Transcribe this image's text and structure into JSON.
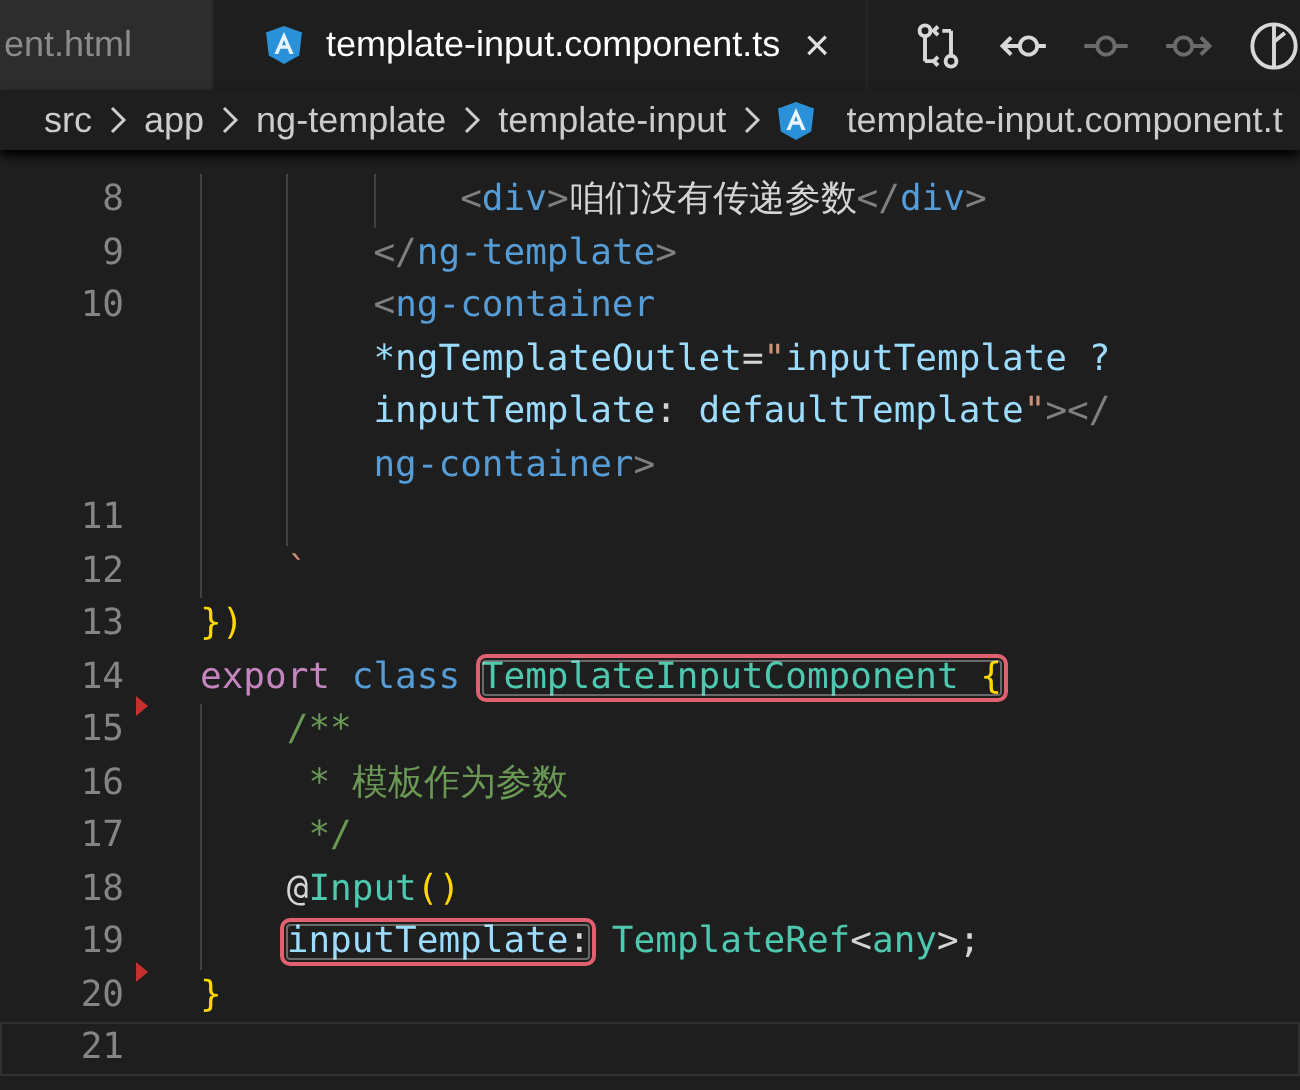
{
  "tabs": [
    {
      "label": "ent.html",
      "selected": false,
      "icon": false
    },
    {
      "label": "template-input.component.ts",
      "selected": true,
      "icon": true,
      "close": "×"
    }
  ],
  "toolbar": [
    {
      "kind": "compare",
      "disabled": false
    },
    {
      "kind": "previous",
      "disabled": false
    },
    {
      "kind": "commit",
      "disabled": true
    },
    {
      "kind": "next",
      "disabled": true
    },
    {
      "kind": "graph",
      "disabled": false
    }
  ],
  "breadcrumb": [
    {
      "label": "src",
      "icon": false
    },
    {
      "label": "app",
      "icon": false
    },
    {
      "label": "ng-template",
      "icon": false
    },
    {
      "label": "template-input",
      "icon": false
    },
    {
      "label": "template-input.component.t",
      "icon": true
    }
  ],
  "lines": [
    {
      "number": "8",
      "marker": false,
      "current": false,
      "rows": [
        {
          "indent": [
            {
              "guide": true
            },
            {
              "guide": true
            },
            {
              "guide": true
            }
          ],
          "tokens": [
            {
              "text": "<",
              "kind": "bracket"
            },
            {
              "text": "div",
              "kind": "tag"
            },
            {
              "text": ">",
              "kind": "bracket"
            },
            {
              "text": "咱们没有传递参数",
              "kind": "text"
            },
            {
              "text": "</",
              "kind": "bracket"
            },
            {
              "text": "div",
              "kind": "tag"
            },
            {
              "text": ">",
              "kind": "bracket"
            }
          ]
        }
      ]
    },
    {
      "number": "9",
      "marker": false,
      "current": false,
      "rows": [
        {
          "indent": [
            {
              "guide": true
            },
            {
              "guide": true
            }
          ],
          "tokens": [
            {
              "text": "</",
              "kind": "bracket"
            },
            {
              "text": "ng-template",
              "kind": "tag"
            },
            {
              "text": ">",
              "kind": "bracket"
            }
          ]
        }
      ]
    },
    {
      "number": "10",
      "marker": false,
      "current": false,
      "rows": [
        {
          "indent": [
            {
              "guide": true
            },
            {
              "guide": true
            }
          ],
          "tokens": [
            {
              "text": "<",
              "kind": "bracket"
            },
            {
              "text": "ng-container",
              "kind": "tag"
            }
          ]
        },
        {
          "indent": [
            {
              "guide": true
            },
            {
              "guide": true
            }
          ],
          "tokens": [
            {
              "text": "*ngTemplateOutlet",
              "kind": "attr"
            },
            {
              "text": "=",
              "kind": "text"
            },
            {
              "text": "\"",
              "kind": "string"
            },
            {
              "text": "inputTemplate ?",
              "kind": "attr"
            }
          ]
        },
        {
          "indent": [
            {
              "guide": true
            },
            {
              "guide": true
            }
          ],
          "tokens": [
            {
              "text": "inputTemplate",
              "kind": "attr"
            },
            {
              "text": ": ",
              "kind": "text"
            },
            {
              "text": "defaultTemplate",
              "kind": "attr"
            },
            {
              "text": "\"",
              "kind": "string"
            },
            {
              "text": "></",
              "kind": "bracket"
            }
          ]
        },
        {
          "indent": [
            {
              "guide": true
            },
            {
              "guide": true
            }
          ],
          "tokens": [
            {
              "text": "ng-container",
              "kind": "tag"
            },
            {
              "text": ">",
              "kind": "bracket"
            }
          ]
        }
      ]
    },
    {
      "number": "11",
      "marker": false,
      "current": false,
      "rows": [
        {
          "indent": [
            {
              "guide": true
            },
            {
              "guide": true
            }
          ]
        }
      ]
    },
    {
      "number": "12",
      "marker": false,
      "current": false,
      "rows": [
        {
          "indent": [
            {
              "guide": true
            }
          ],
          "tokens": [
            {
              "text": "`",
              "kind": "string"
            }
          ]
        }
      ]
    },
    {
      "number": "13",
      "marker": false,
      "current": false,
      "rows": [
        {
          "tokens": [
            {
              "text": "}",
              "kind": "brace"
            },
            {
              "text": ")",
              "kind": "paren"
            }
          ]
        }
      ]
    },
    {
      "number": "14",
      "marker": false,
      "current": false,
      "rows": [
        {
          "tokens": [
            {
              "text": "export ",
              "kind": "keyword"
            },
            {
              "text": "class ",
              "kind": "storage"
            },
            {
              "text": "TemplateInputComponent ",
              "kind": "type",
              "boxed": true
            },
            {
              "text": "{",
              "kind": "brace",
              "boxed": true
            }
          ]
        }
      ]
    },
    {
      "number": "15",
      "marker": true,
      "current": false,
      "rows": [
        {
          "indent": [
            {
              "guide": true
            }
          ],
          "tokens": [
            {
              "text": "/**",
              "kind": "comment"
            }
          ]
        }
      ]
    },
    {
      "number": "16",
      "marker": false,
      "current": false,
      "rows": [
        {
          "indent": [
            {
              "guide": true
            }
          ],
          "tokens": [
            {
              "text": " * 模板作为参数",
              "kind": "comment"
            }
          ]
        }
      ]
    },
    {
      "number": "17",
      "marker": false,
      "current": false,
      "rows": [
        {
          "indent": [
            {
              "guide": true
            }
          ],
          "tokens": [
            {
              "text": " */",
              "kind": "comment"
            }
          ]
        }
      ]
    },
    {
      "number": "18",
      "marker": false,
      "current": false,
      "rows": [
        {
          "indent": [
            {
              "guide": true
            }
          ],
          "tokens": [
            {
              "text": "@",
              "kind": "text"
            },
            {
              "text": "Input",
              "kind": "type"
            },
            {
              "text": "()",
              "kind": "paren"
            }
          ]
        }
      ]
    },
    {
      "number": "19",
      "marker": false,
      "current": false,
      "rows": [
        {
          "indent": [
            {
              "guide": true
            }
          ],
          "tokens": [
            {
              "text": "inputTemplate",
              "kind": "attr",
              "boxed": true
            },
            {
              "text": ":",
              "kind": "text",
              "boxed": true
            },
            {
              "text": " TemplateRef",
              "kind": "type"
            },
            {
              "text": "<",
              "kind": "text"
            },
            {
              "text": "any",
              "kind": "type"
            },
            {
              "text": ">;",
              "kind": "text"
            }
          ]
        }
      ]
    },
    {
      "number": "20",
      "marker": true,
      "current": false,
      "rows": [
        {
          "tokens": [
            {
              "text": "}",
              "kind": "brace"
            }
          ]
        }
      ]
    },
    {
      "number": "21",
      "marker": false,
      "current": true,
      "rows": [
        {}
      ]
    }
  ]
}
